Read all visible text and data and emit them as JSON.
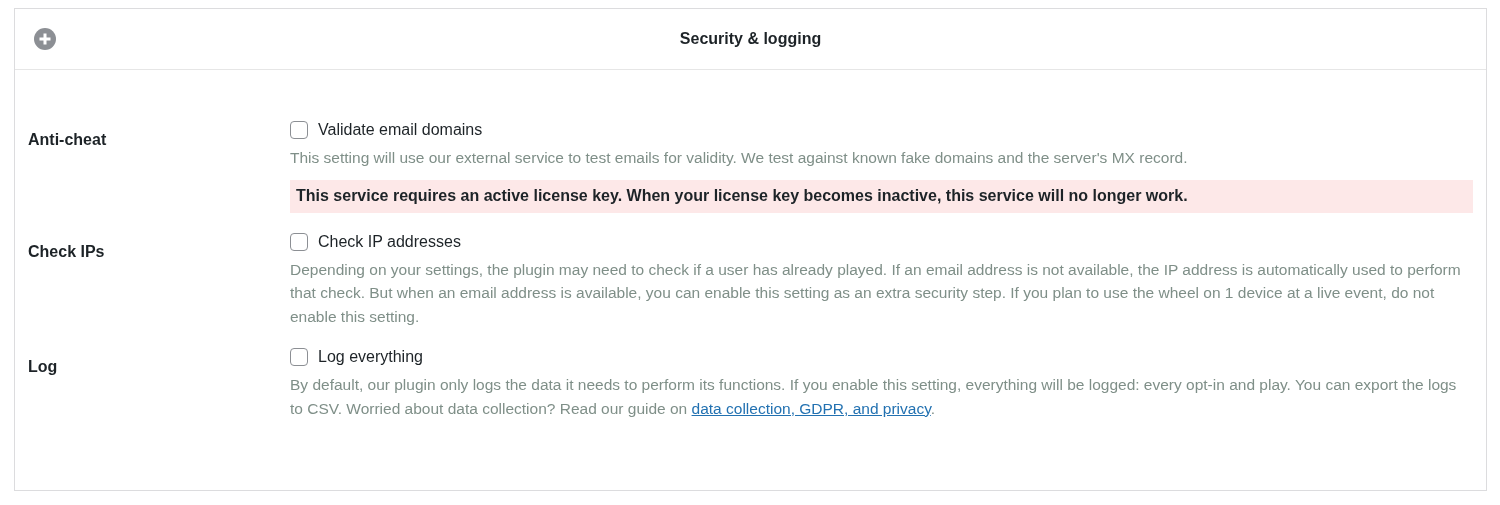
{
  "panel": {
    "title": "Security & logging",
    "expanded": false
  },
  "settings": [
    {
      "label": "Anti-cheat",
      "option": "Validate email domains",
      "checked": false,
      "description": "This setting will use our external service to test emails for validity. We test against known fake domains and the server's MX record.",
      "notice": "This service requires an active license key. When your license key becomes inactive, this service will no longer work."
    },
    {
      "label": "Check IPs",
      "option": "Check IP addresses",
      "checked": false,
      "description": "Depending on your settings, the plugin may need to check if a user has already played. If an email address is not available, the IP address is automatically used to perform that check. But when an email address is available, you can enable this setting as an extra security step. If you plan to use the wheel on 1 device at a live event, do not enable this setting."
    },
    {
      "label": "Log",
      "option": "Log everything",
      "checked": false,
      "description": "By default, our plugin only logs the data it needs to perform its functions. If you enable this setting, everything will be logged: every opt-in and play. You can export the logs to CSV. Worried about data collection? Read our guide on",
      "link": "data collection, GDPR, and privacy",
      "description_end": "."
    }
  ]
}
